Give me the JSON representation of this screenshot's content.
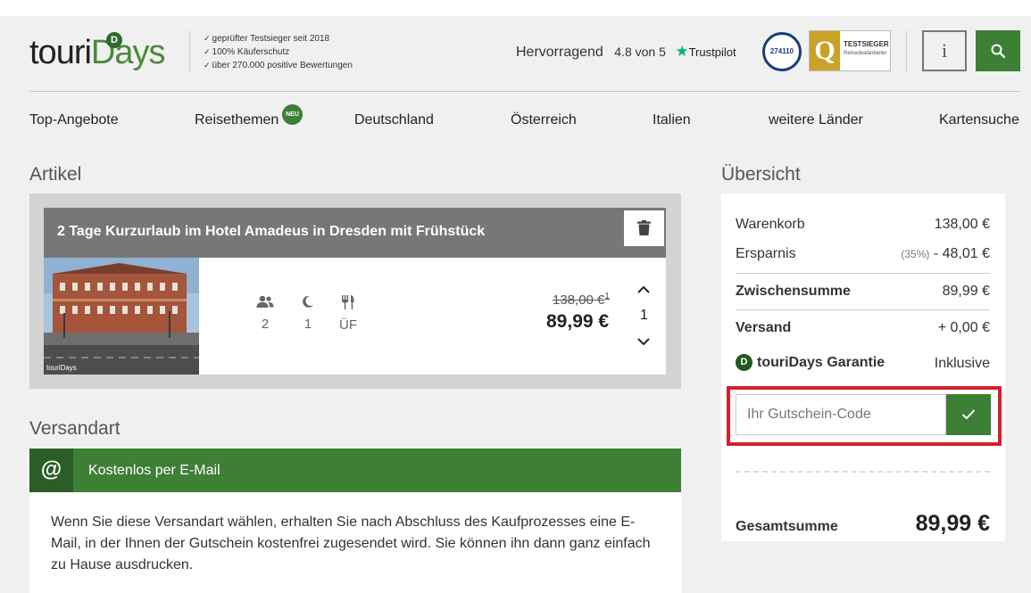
{
  "header": {
    "logo_text_a": "touri",
    "logo_text_b": "Days",
    "logo_mark": "D",
    "usp": [
      "geprüfter Testsieger seit 2018",
      "100% Käuferschutz",
      "über 270.000 positive Bewertungen"
    ],
    "trust_label": "Hervorragend",
    "trust_score": "4.8 von 5",
    "trust_brand": "Trustpilot",
    "badge_number": "274110",
    "badge2_title": "TESTSIEGER",
    "badge2_sub": "Reisedealanbieter",
    "info_label": "i",
    "search_icon": "search-icon",
    "check_glyph": "✓"
  },
  "nav": {
    "items": [
      "Top-Angebote",
      "Reisethemen",
      "Deutschland",
      "Österreich",
      "Italien",
      "weitere Länder",
      "Kartensuche"
    ],
    "new_badge": "NEU"
  },
  "article": {
    "section_title": "Artikel",
    "title": "2 Tage Kurzurlaub im Hotel Amadeus in Dresden mit Frühstück",
    "image_watermark": "touriDays",
    "persons": "2",
    "nights": "1",
    "board": "ÜF",
    "old_price": "138,00 €",
    "old_price_note": "1",
    "price": "89,99 €",
    "quantity": "1"
  },
  "shipping": {
    "section_title": "Versandart",
    "icon": "@",
    "label": "Kostenlos per E-Mail",
    "text": "Wenn Sie diese Versandart wählen, erhalten Sie nach Abschluss des Kaufprozesses eine E-Mail, in der Ihnen der Gutschein kostenfrei zugesendet wird. Sie können ihn dann ganz einfach zu Hause ausdrucken."
  },
  "summary": {
    "section_title": "Übersicht",
    "cart_label": "Warenkorb",
    "cart_value": "138,00 €",
    "saving_label": "Ersparnis",
    "saving_pct": "(35%)",
    "saving_value": "- 48,01 €",
    "subtotal_label": "Zwischensumme",
    "subtotal_value": "89,99 €",
    "shipping_label": "Versand",
    "shipping_value": "+ 0,00 €",
    "guarantee_mark": "D",
    "guarantee_label": "touriDays Garantie",
    "guarantee_value": "Inklusive",
    "voucher_placeholder": "Ihr Gutschein-Code",
    "total_label": "Gesamtsumme",
    "total_value": "89,99 €"
  },
  "colors": {
    "brand_green": "#3e7f36",
    "highlight_red": "#d3202b",
    "trustpilot_green": "#00b67a"
  }
}
